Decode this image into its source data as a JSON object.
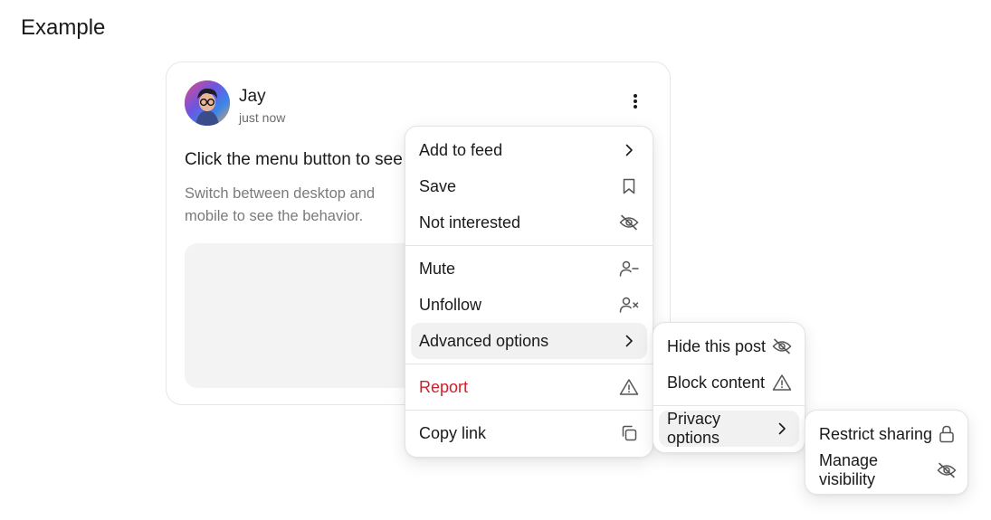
{
  "page": {
    "title": "Example"
  },
  "post": {
    "author": "Jay",
    "timestamp": "just now",
    "title": "Click the menu button to see",
    "body": "Switch between desktop and mobile to see the behavior."
  },
  "menu": {
    "items": [
      {
        "label": "Add to feed",
        "icon": "chevron-right-icon"
      },
      {
        "label": "Save",
        "icon": "bookmark-icon"
      },
      {
        "label": "Not interested",
        "icon": "eye-off-icon"
      },
      {
        "label": "Mute",
        "icon": "user-minus-icon"
      },
      {
        "label": "Unfollow",
        "icon": "user-x-icon"
      },
      {
        "label": "Advanced options",
        "icon": "chevron-right-icon"
      },
      {
        "label": "Report",
        "icon": "warning-icon",
        "color": "#d0202a"
      },
      {
        "label": "Copy link",
        "icon": "copy-icon"
      }
    ]
  },
  "advanced_menu": {
    "items": [
      {
        "label": "Hide this post",
        "icon": "eye-off-icon"
      },
      {
        "label": "Block content",
        "icon": "warning-icon"
      },
      {
        "label": "Privacy options",
        "icon": "chevron-right-icon"
      }
    ]
  },
  "privacy_menu": {
    "items": [
      {
        "label": "Restrict sharing",
        "icon": "lock-icon"
      },
      {
        "label": "Manage visibility",
        "icon": "eye-off-icon"
      }
    ]
  },
  "colors": {
    "danger": "#d0202a",
    "hover_bg": "#f1f1f1",
    "muted_text": "#7a7a7a",
    "media_bg": "#f3f3f3"
  }
}
